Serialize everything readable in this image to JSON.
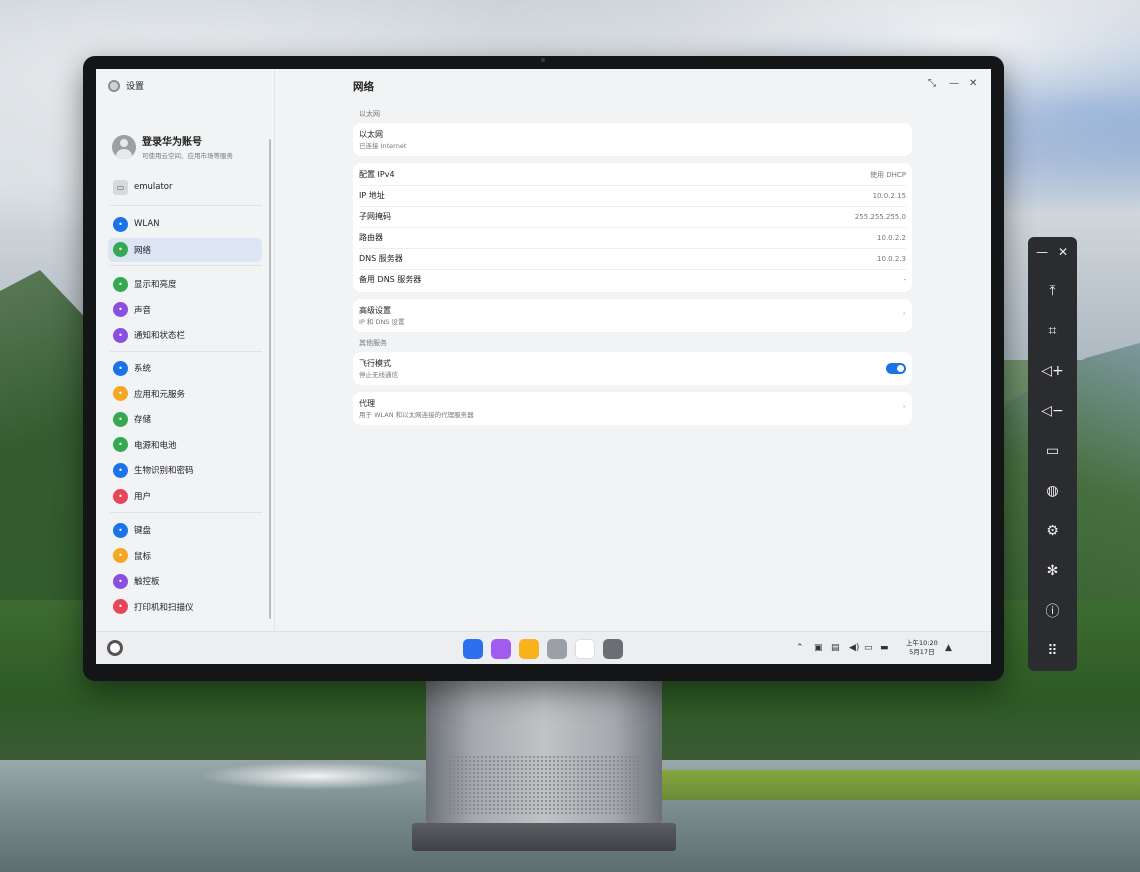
{
  "settings_app": {
    "title": "设置",
    "account": {
      "name": "登录华为账号",
      "subtitle": "可使用云空间、应用市场等服务"
    },
    "device": "emulator",
    "nav_groups": [
      [
        {
          "label": "WLAN",
          "icon": "wifi-icon",
          "color": "#1a73e8",
          "active": false
        },
        {
          "label": "网络",
          "icon": "globe-icon",
          "color": "#34a853",
          "active": true
        }
      ],
      [
        {
          "label": "显示和亮度",
          "icon": "display-icon",
          "color": "#34a853",
          "active": false
        },
        {
          "label": "声音",
          "icon": "sound-icon",
          "color": "#8a4fe0",
          "active": false
        },
        {
          "label": "通知和状态栏",
          "icon": "bell-icon",
          "color": "#8a4fe0",
          "active": false
        }
      ],
      [
        {
          "label": "系统",
          "icon": "gear-icon",
          "color": "#1a73e8",
          "active": false
        },
        {
          "label": "应用和元服务",
          "icon": "apps-icon",
          "color": "#f5a623",
          "active": false
        },
        {
          "label": "存储",
          "icon": "storage-icon",
          "color": "#34a853",
          "active": false
        },
        {
          "label": "电源和电池",
          "icon": "battery-icon",
          "color": "#34a853",
          "active": false
        },
        {
          "label": "生物识别和密码",
          "icon": "key-icon",
          "color": "#1a73e8",
          "active": false
        },
        {
          "label": "用户",
          "icon": "user-icon",
          "color": "#e8455b",
          "active": false
        }
      ],
      [
        {
          "label": "键盘",
          "icon": "keyboard-icon",
          "color": "#1a73e8",
          "active": false
        },
        {
          "label": "鼠标",
          "icon": "mouse-icon",
          "color": "#f5a623",
          "active": false
        },
        {
          "label": "触控板",
          "icon": "touchpad-icon",
          "color": "#8a4fe0",
          "active": false
        },
        {
          "label": "打印机和扫描仪",
          "icon": "printer-icon",
          "color": "#e8455b",
          "active": false
        }
      ]
    ]
  },
  "network_page": {
    "title": "网络",
    "ethernet_section": "以太网",
    "ethernet_card": {
      "label": "以太网",
      "status": "已连接 Internet"
    },
    "ip_rows": [
      {
        "label": "配置 IPv4",
        "value": "使用 DHCP"
      },
      {
        "label": "IP 地址",
        "value": "10.0.2.15"
      },
      {
        "label": "子网掩码",
        "value": "255.255.255.0"
      },
      {
        "label": "路由器",
        "value": "10.0.2.2"
      },
      {
        "label": "DNS 服务器",
        "value": "10.0.2.3"
      },
      {
        "label": "备用 DNS 服务器",
        "value": "-"
      }
    ],
    "advanced": {
      "label": "高级设置",
      "sub": "IP 和 DNS 设置"
    },
    "other_section": "其他服务",
    "airplane": {
      "label": "飞行模式",
      "sub": "停止无线通信",
      "enabled": true
    },
    "proxy": {
      "label": "代理",
      "sub": "用于 WLAN 和以太网连接的代理服务器"
    }
  },
  "taskbar": {
    "dock_apps": [
      {
        "icon": "app-center-icon",
        "color": "#2d6ff0"
      },
      {
        "icon": "gallery-icon",
        "color": "#a05cf0"
      },
      {
        "icon": "files-icon",
        "color": "#f7b21d"
      },
      {
        "icon": "trash-icon",
        "color": "#9aa0a6"
      },
      {
        "icon": "photos-icon",
        "color": "#ffffff"
      },
      {
        "icon": "settings-icon",
        "color": "#6b6f74"
      }
    ],
    "time": "上午10:20",
    "date": "5月17日"
  },
  "emulator_toolbar": {
    "buttons": [
      {
        "icon": "pin-top-icon",
        "glyph": "⤒"
      },
      {
        "icon": "crop-icon",
        "glyph": "⌗"
      },
      {
        "icon": "volume-up-icon",
        "glyph": "◁+"
      },
      {
        "icon": "volume-down-icon",
        "glyph": "◁−"
      },
      {
        "icon": "battery-icon",
        "glyph": "▭"
      },
      {
        "icon": "globe-icon",
        "glyph": "◍"
      },
      {
        "icon": "gear-icon",
        "glyph": "⚙"
      },
      {
        "icon": "bug-icon",
        "glyph": "✻"
      },
      {
        "icon": "info-icon",
        "glyph": "ⓘ"
      },
      {
        "icon": "more-icon",
        "glyph": "⠿"
      }
    ]
  }
}
